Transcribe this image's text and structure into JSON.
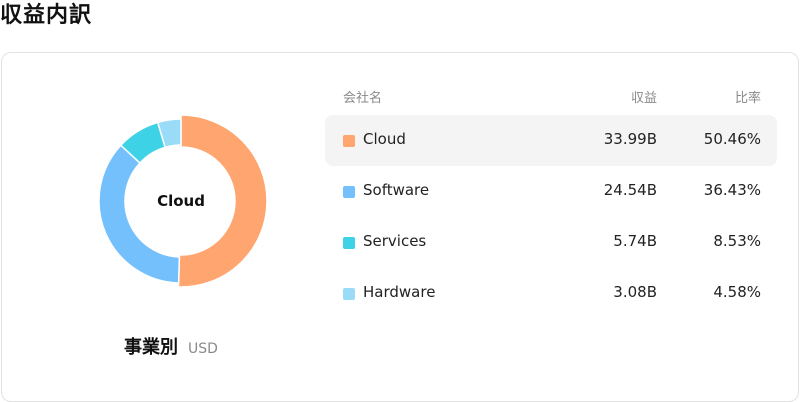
{
  "page": {
    "title": "収益内訳"
  },
  "chart_data": {
    "type": "pie",
    "center_label": "Cloud",
    "breakdown_title": "事業別",
    "unit": "USD",
    "headers": {
      "name": "会社名",
      "revenue": "収益",
      "ratio": "比率"
    },
    "segments": [
      {
        "name": "Cloud",
        "revenue": "33.99B",
        "ratio": "50.46%",
        "value": 50.46,
        "color": "#FFA56F"
      },
      {
        "name": "Software",
        "revenue": "24.54B",
        "ratio": "36.43%",
        "value": 36.43,
        "color": "#74C0FC"
      },
      {
        "name": "Services",
        "revenue": "5.74B",
        "ratio": "8.53%",
        "value": 8.53,
        "color": "#3ED2E6"
      },
      {
        "name": "Hardware",
        "revenue": "3.08B",
        "ratio": "4.58%",
        "value": 4.58,
        "color": "#9ADCF8"
      }
    ],
    "selected_index": 0
  }
}
